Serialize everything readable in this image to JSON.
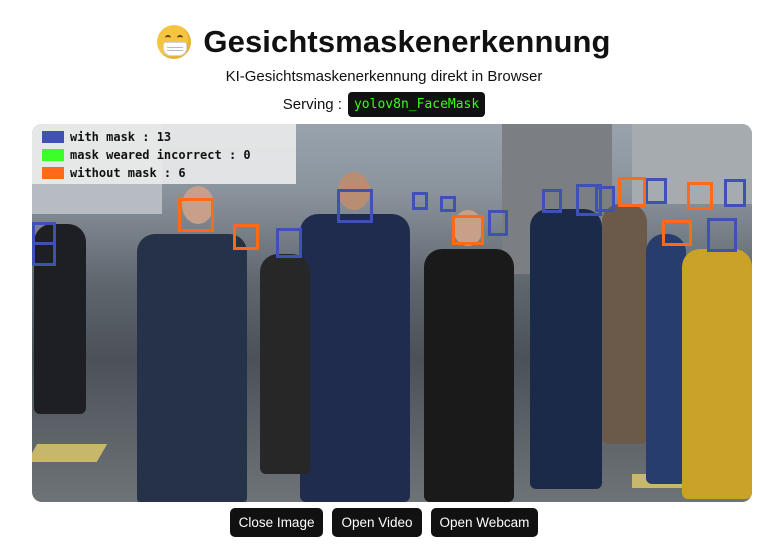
{
  "header": {
    "title": "Gesichtsmaskenerkennung",
    "icon": "face-with-medical-mask-icon"
  },
  "subtitle": "KI-Gesichtsmaskenerkennung direkt in Browser",
  "serving": {
    "label": "Serving :",
    "model": "yolov8n_FaceMask"
  },
  "legend": {
    "items": [
      {
        "label": "with mask : 13",
        "color": "#3f51b5"
      },
      {
        "label": "mask weared incorrect : 0",
        "color": "#3cff2a"
      },
      {
        "label": "without mask : 6",
        "color": "#ff6a1a"
      }
    ]
  },
  "buttons": {
    "close_image": "Close Image",
    "open_video": "Open Video",
    "open_webcam": "Open Webcam"
  }
}
